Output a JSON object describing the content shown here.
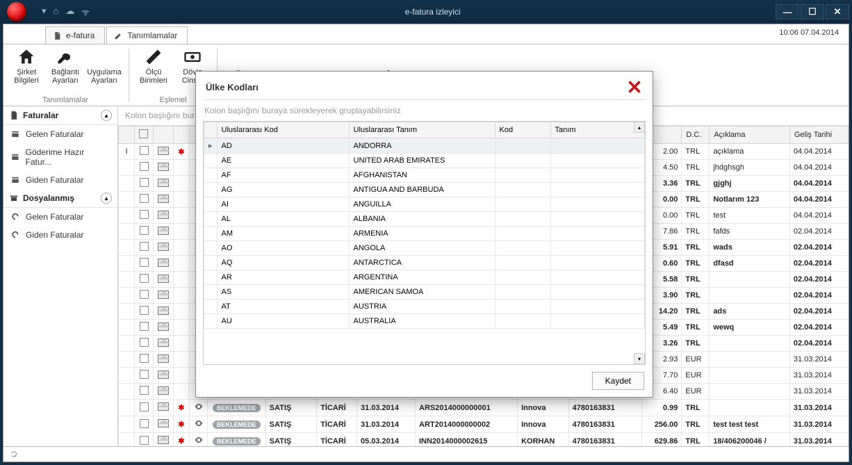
{
  "window": {
    "title": "e-fatura izleyici",
    "datetime": "10:06 07.04.2014"
  },
  "tabs": {
    "efatura": "e-fatura",
    "tanimlamalar": "Tanımlamalar"
  },
  "ribbon": {
    "group1_label": "Tanımlamalar",
    "btn_sirket": "Şirket Bilgileri",
    "btn_baglanti": "Bağlantı Ayarları",
    "btn_uygulama": "Uygulama Ayarları",
    "group2_label": "Eşlemel",
    "btn_olcu": "Ölçü Birimleri",
    "btn_doviz": "Döviz Cinsle"
  },
  "sidebar": {
    "faturalar": "Faturalar",
    "items1": [
      "Gelen Faturalar",
      "Göderime Hazır Fatur...",
      "Giden Faturalar"
    ],
    "dosyalanmis": "Dosyalanmış",
    "items2": [
      "Gelen Faturalar",
      "Giden Faturalar"
    ]
  },
  "grid": {
    "group_hint": "Kolon başlığını buraya",
    "cols": {
      "dc": "D.C.",
      "aciklama": "Açıklama",
      "gelis": "Geliş Tarihi"
    },
    "hidden_cols": {
      "tur": "SATIŞ",
      "senaryo": "TİCARİ"
    },
    "rows": [
      {
        "bold": false,
        "amt": "2.00",
        "dc": "TRL",
        "ack": "açıklama",
        "gel": "04.04.2014"
      },
      {
        "bold": false,
        "amt": "4.50",
        "dc": "TRL",
        "ack": "jhdghsgh",
        "gel": "04.04.2014"
      },
      {
        "bold": true,
        "amt": "3.36",
        "dc": "TRL",
        "ack": "gjghj",
        "gel": "04.04.2014"
      },
      {
        "bold": true,
        "amt": "0.00",
        "dc": "TRL",
        "ack": "Notlarım 123",
        "gel": "04.04.2014"
      },
      {
        "bold": false,
        "amt": "0.00",
        "dc": "TRL",
        "ack": "test",
        "gel": "04.04.2014"
      },
      {
        "bold": false,
        "amt": "7.86",
        "dc": "TRL",
        "ack": "fafds",
        "gel": "02.04.2014"
      },
      {
        "bold": true,
        "amt": "5.91",
        "dc": "TRL",
        "ack": "wads",
        "gel": "02.04.2014"
      },
      {
        "bold": true,
        "amt": "0.60",
        "dc": "TRL",
        "ack": "dfasd",
        "gel": "02.04.2014"
      },
      {
        "bold": true,
        "amt": "5.58",
        "dc": "TRL",
        "ack": "",
        "gel": "02.04.2014"
      },
      {
        "bold": true,
        "amt": "3.90",
        "dc": "TRL",
        "ack": "",
        "gel": "02.04.2014"
      },
      {
        "bold": true,
        "amt": "14.20",
        "dc": "TRL",
        "ack": "ads",
        "gel": "02.04.2014"
      },
      {
        "bold": true,
        "amt": "5.49",
        "dc": "TRL",
        "ack": "wewq",
        "gel": "02.04.2014"
      },
      {
        "bold": true,
        "amt": "3.26",
        "dc": "TRL",
        "ack": "",
        "gel": "02.04.2014"
      },
      {
        "bold": false,
        "amt": "2.93",
        "dc": "EUR",
        "ack": "",
        "gel": "31.03.2014"
      },
      {
        "bold": false,
        "amt": "7.70",
        "dc": "EUR",
        "ack": "",
        "gel": "31.03.2014"
      },
      {
        "bold": false,
        "amt": "6.40",
        "dc": "EUR",
        "ack": "",
        "gel": "31.03.2014"
      }
    ],
    "bottom_rows": [
      {
        "badge": "BEKLEMEDE",
        "tur": "SATIŞ",
        "sen": "TİCARİ",
        "tarih": "31.03.2014",
        "no": "ARS2014000000001",
        "alici": "Innova",
        "vkn": "4780163831",
        "amt": "0.99",
        "dc": "TRL",
        "ack": "",
        "gel": "31.03.2014"
      },
      {
        "badge": "BEKLEMEDE",
        "tur": "SATIŞ",
        "sen": "TİCARİ",
        "tarih": "31.03.2014",
        "no": "ART2014000000002",
        "alici": "Innova",
        "vkn": "4780163831",
        "amt": "256.00",
        "dc": "TRL",
        "ack": "test test test",
        "gel": "31.03.2014"
      },
      {
        "badge": "BEKLEMEDE",
        "tur": "SATIŞ",
        "sen": "TİCARİ",
        "tarih": "05.03.2014",
        "no": "INN2014000002615",
        "alici": "KORHAN",
        "vkn": "4780163831",
        "amt": "629.86",
        "dc": "TRL",
        "ack": "18/406200046 /",
        "gel": "31.03.2014"
      }
    ]
  },
  "modal": {
    "title": "Ülke Kodları",
    "group_hint": "Kolon başlığını buraya sürekleyerek gruplayabilirsiniz",
    "cols": {
      "kod": "Uluslararası Kod",
      "tanim": "Uluslararası Tanım",
      "kod2": "Kod",
      "tanim2": "Tanım"
    },
    "rows": [
      {
        "k": "AD",
        "t": "ANDORRA"
      },
      {
        "k": "AE",
        "t": "UNITED ARAB EMIRATES"
      },
      {
        "k": "AF",
        "t": "AFGHANISTAN"
      },
      {
        "k": "AG",
        "t": "ANTIGUA AND BARBUDA"
      },
      {
        "k": "AI",
        "t": "ANGUILLA"
      },
      {
        "k": "AL",
        "t": "ALBANIA"
      },
      {
        "k": "AM",
        "t": "ARMENIA"
      },
      {
        "k": "AO",
        "t": "ANGOLA"
      },
      {
        "k": "AQ",
        "t": "ANTARCTICA"
      },
      {
        "k": "AR",
        "t": "ARGENTINA"
      },
      {
        "k": "AS",
        "t": "AMERICAN SAMOA"
      },
      {
        "k": "AT",
        "t": "AUSTRIA"
      },
      {
        "k": "AU",
        "t": "AUSTRALIA"
      }
    ],
    "save": "Kaydet"
  }
}
